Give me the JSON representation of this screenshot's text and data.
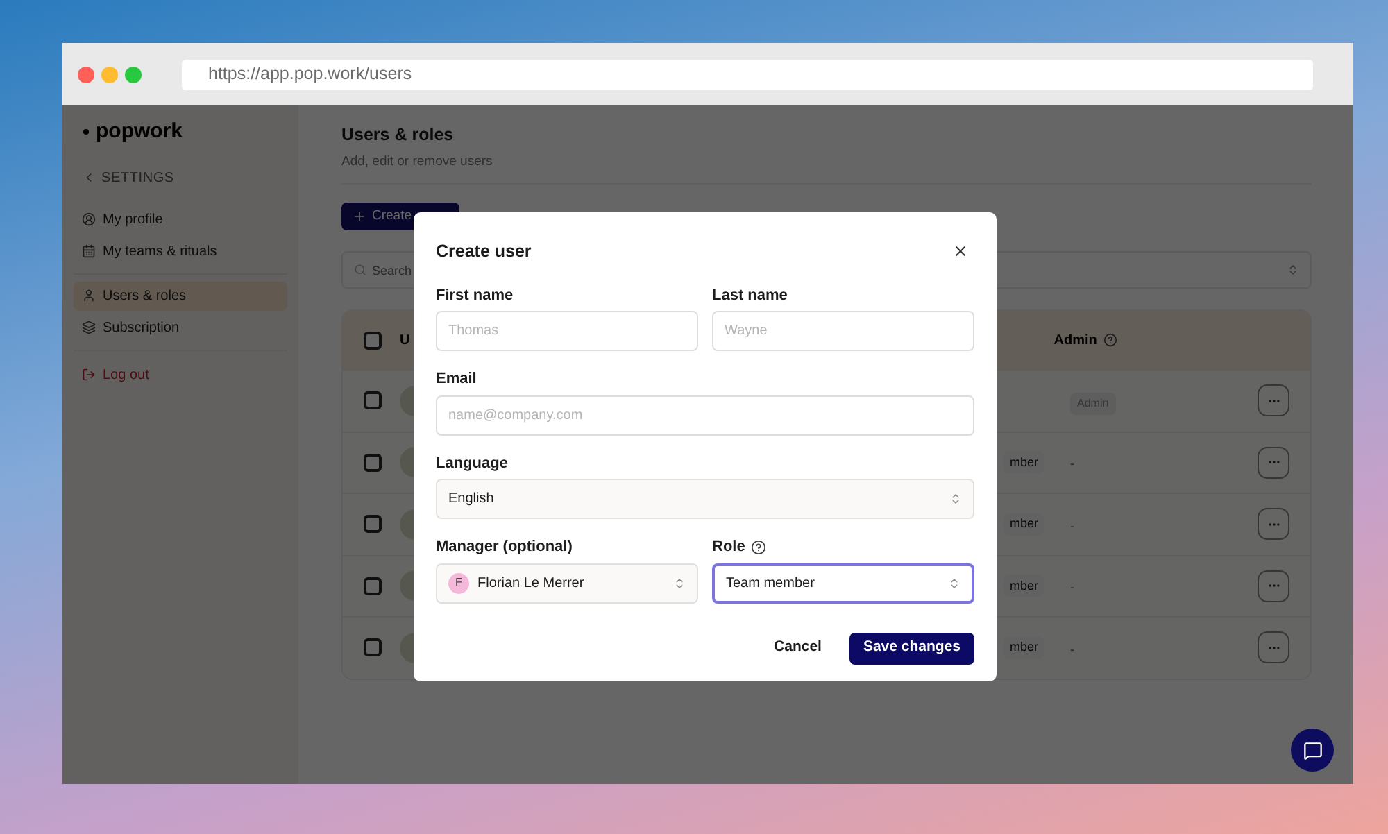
{
  "browser": {
    "url": "https://app.pop.work/users"
  },
  "sidebar": {
    "logo": "popwork",
    "back": "SETTINGS",
    "groups": [
      [
        {
          "label": "My profile",
          "selected": false
        },
        {
          "label": "My teams & rituals",
          "selected": false
        }
      ],
      [
        {
          "label": "Users & roles",
          "selected": true
        },
        {
          "label": "Subscription",
          "selected": false
        }
      ]
    ],
    "logout": "Log out"
  },
  "page": {
    "title": "Users & roles",
    "subtitle": "Add, edit or remove users",
    "create_button": "Create",
    "search": {
      "placeholder": "Search"
    }
  },
  "table": {
    "header": {
      "checked": false,
      "column_2": "U",
      "admin": "Admin"
    },
    "rows": [
      {
        "checked": false,
        "admin": {
          "kind": "badge",
          "text": "Admin"
        }
      },
      {
        "checked": false,
        "role": "mber",
        "admin": {
          "kind": "text",
          "text": "-"
        }
      },
      {
        "checked": false,
        "role": "mber",
        "admin": {
          "kind": "text",
          "text": "-"
        }
      },
      {
        "checked": false,
        "role": "mber",
        "admin": {
          "kind": "text",
          "text": "-"
        }
      },
      {
        "checked": false,
        "role": "mber",
        "admin": {
          "kind": "text",
          "text": "-"
        }
      }
    ]
  },
  "modal": {
    "title": "Create user",
    "first_name": {
      "label": "First name",
      "placeholder": "Thomas"
    },
    "last_name": {
      "label": "Last name",
      "placeholder": "Wayne"
    },
    "email": {
      "label": "Email",
      "placeholder": "name@company.com"
    },
    "language": {
      "label": "Language",
      "value": "English"
    },
    "manager": {
      "label": "Manager (optional)",
      "initial": "F",
      "value": "Florian Le Merrer"
    },
    "role": {
      "label": "Role",
      "value": "Team member",
      "focused": true
    },
    "cancel": "Cancel",
    "save": "Save changes"
  }
}
